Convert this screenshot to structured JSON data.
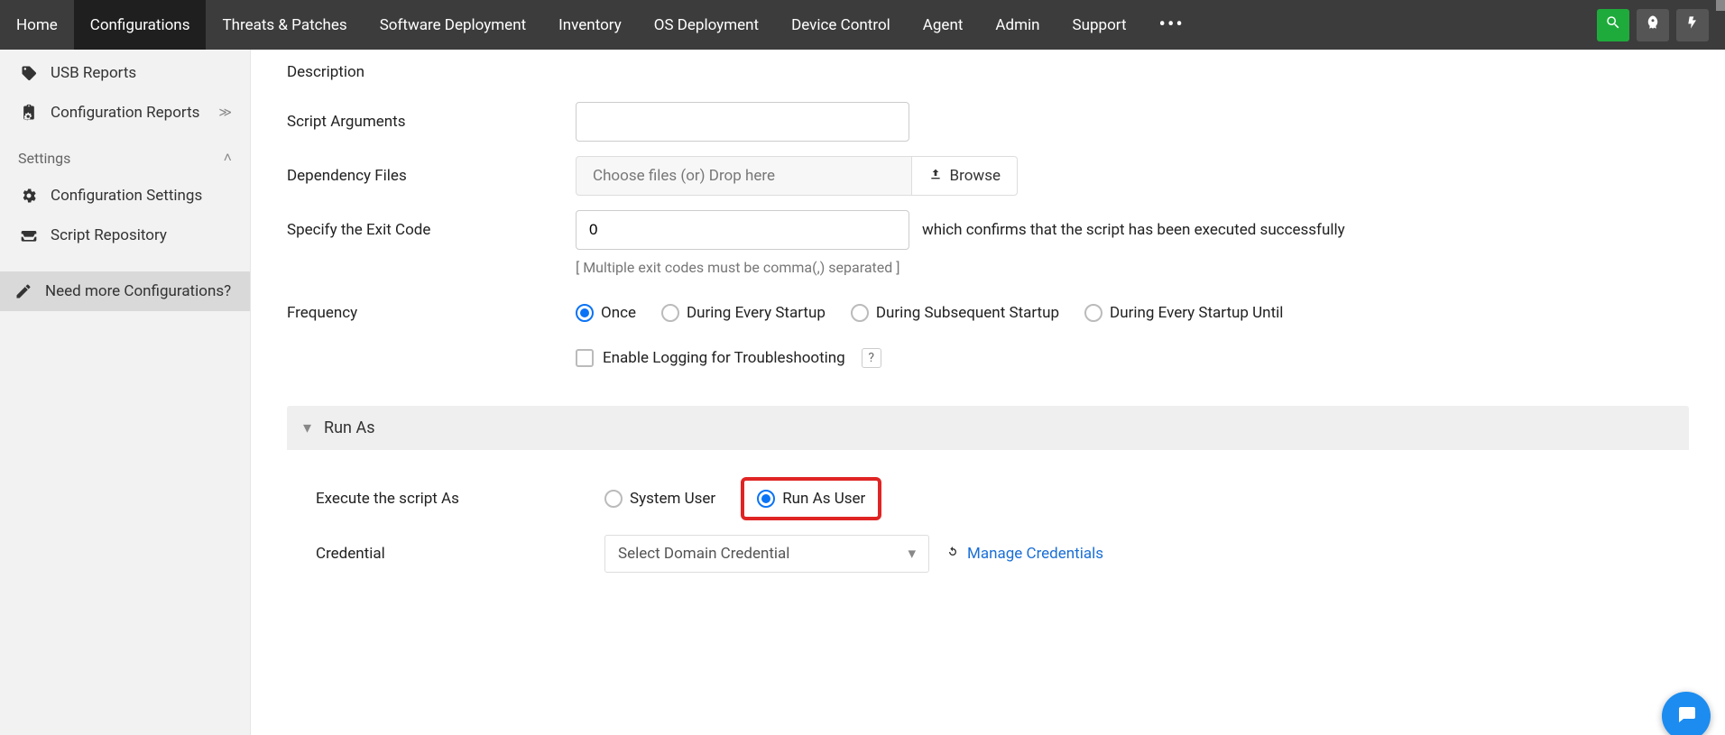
{
  "topnav": {
    "items": [
      "Home",
      "Configurations",
      "Threats & Patches",
      "Software Deployment",
      "Inventory",
      "OS Deployment",
      "Device Control",
      "Agent",
      "Admin",
      "Support"
    ],
    "active_index": 1,
    "more_glyph": "•••"
  },
  "sidebar": {
    "items": [
      {
        "label": "USB Reports"
      },
      {
        "label": "Configuration Reports",
        "has_chevron": true
      }
    ],
    "section_title": "Settings",
    "settings_items": [
      {
        "label": "Configuration Settings"
      },
      {
        "label": "Script Repository"
      }
    ],
    "need_more": "Need more Configurations?"
  },
  "form": {
    "description_label": "Description",
    "script_args_label": "Script Arguments",
    "script_args_value": "",
    "dep_files_label": "Dependency Files",
    "dep_files_placeholder": "Choose files (or) Drop here",
    "browse_label": "Browse",
    "exit_code_label": "Specify the Exit Code",
    "exit_code_value": "0",
    "exit_code_after": "which confirms that the script has been executed successfully",
    "exit_code_hint": "[ Multiple exit codes must be comma(,) separated ]",
    "frequency_label": "Frequency",
    "frequency_options": [
      "Once",
      "During Every Startup",
      "During Subsequent Startup",
      "During Every Startup Until"
    ],
    "frequency_selected": 0,
    "enable_logging_label": "Enable Logging for Troubleshooting",
    "help_glyph": "?"
  },
  "runas": {
    "title": "Run As",
    "execute_as_label": "Execute the script As",
    "options": [
      "System User",
      "Run As User"
    ],
    "selected": 1,
    "credential_label": "Credential",
    "credential_placeholder": "Select Domain Credential",
    "manage_link": "Manage Credentials"
  }
}
